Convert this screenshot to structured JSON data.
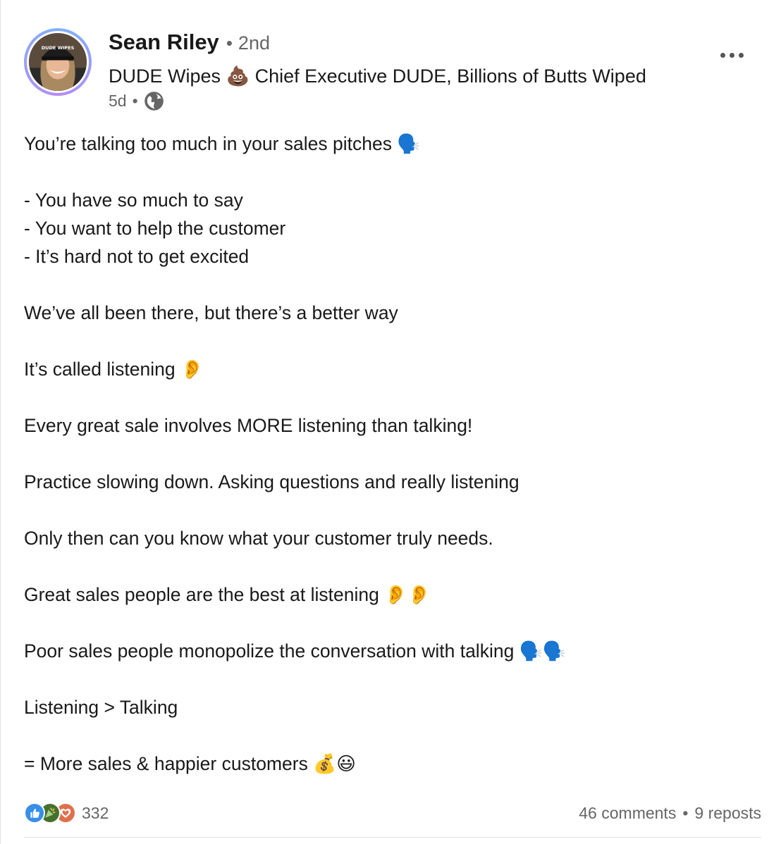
{
  "post": {
    "author": {
      "name": "Sean Riley",
      "degree_separator": "•",
      "degree": "2nd",
      "headline": "DUDE Wipes 💩 Chief Executive DUDE, Billions of Butts Wiped",
      "time": "5d",
      "time_separator": "•",
      "visibility_icon": "globe-icon",
      "avatar_cap_text": "DUDE WIPES"
    },
    "more_icon": "ellipsis-icon",
    "lines": [
      "You’re talking too much in your sales pitches 🗣️",
      "",
      "- You have so much to say",
      "- You want to help the customer",
      "- It’s hard not to get excited",
      "",
      "We’ve all been there, but there’s a better way",
      "",
      "It’s called listening 👂",
      "",
      "Every great sale involves MORE listening than talking!",
      "",
      "Practice slowing down. Asking questions and really listening",
      "",
      "Only then can you know what your customer truly needs.",
      "",
      "Great sales people are the best at listening 👂👂",
      "",
      "Poor sales people monopolize the conversation with talking 🗣️🗣️",
      "",
      "Listening > Talking",
      "",
      "= More sales & happier customers 💰😃"
    ],
    "social": {
      "reaction_icons": [
        "like-icon",
        "celebrate-icon",
        "love-icon"
      ],
      "reaction_count": "332",
      "comments": "46 comments",
      "separator": "•",
      "reposts": "9 reposts"
    }
  },
  "colors": {
    "like": "#378fe9",
    "celebrate": "#44712e",
    "love": "#df704d",
    "avatar_ring": "#b58cf5",
    "secondary_text": "#666666"
  }
}
